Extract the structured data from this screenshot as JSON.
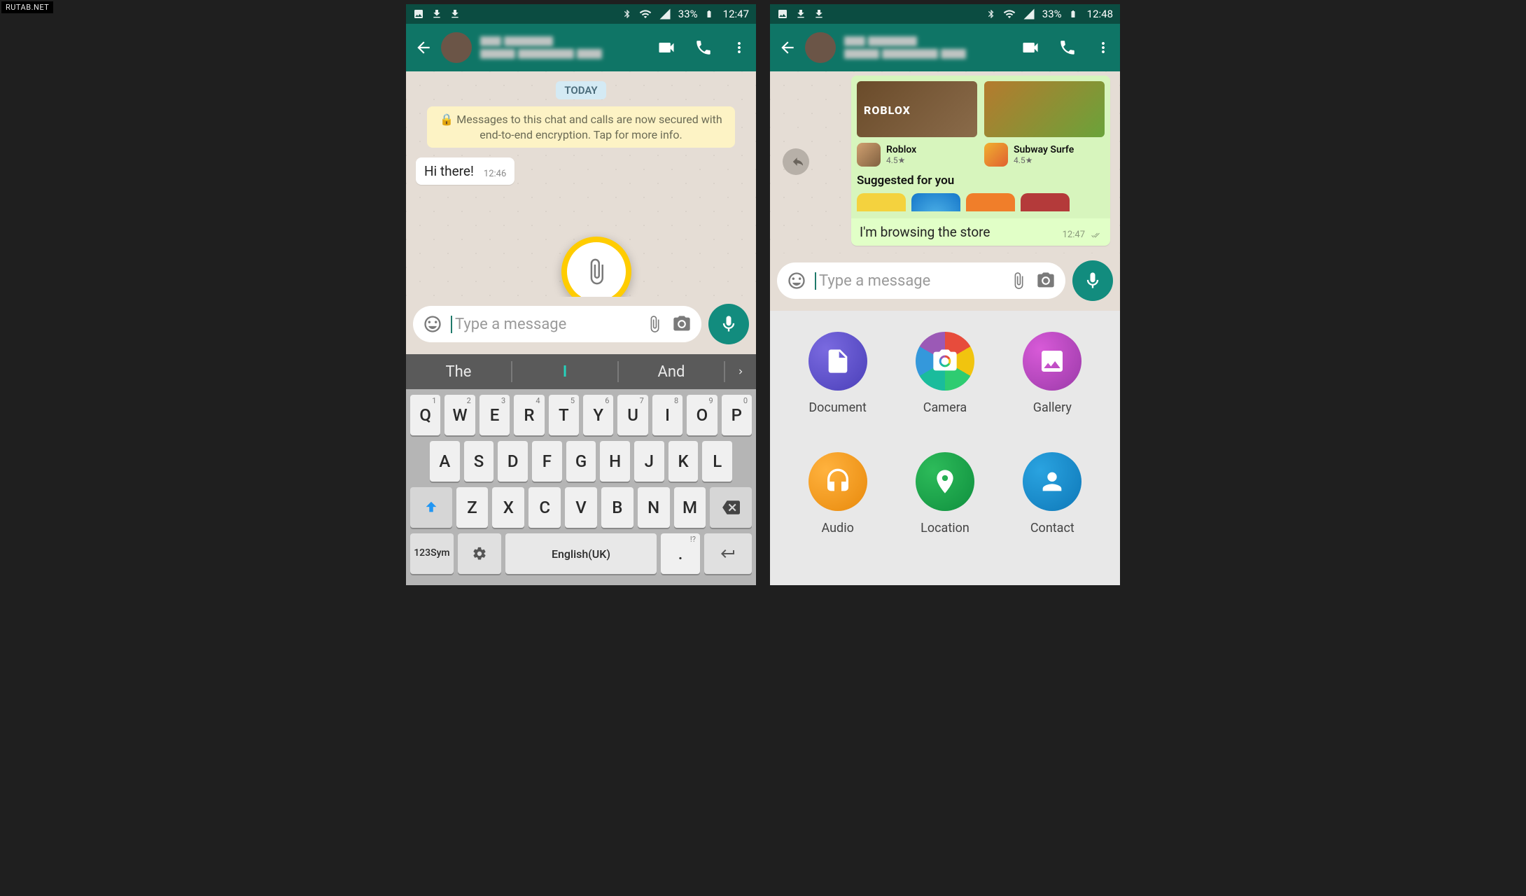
{
  "watermark": "RUTAB.NET",
  "status": {
    "battery": "33%",
    "time_left": "12:47",
    "time_right": "12:48"
  },
  "chat": {
    "day": "TODAY",
    "e2e": "Messages to this chat and calls are now secured with end-to-end encryption. Tap for more info.",
    "incoming": {
      "text": "Hi there!",
      "time": "12:46"
    },
    "outgoing": {
      "app1_name": "Roblox",
      "app1_rating": "4.5★",
      "app2_name": "Subway Surfe",
      "app2_rating": "4.5★",
      "suggested": "Suggested for you",
      "text": "I'm browsing the store",
      "time": "12:47"
    },
    "placeholder": "Type a message"
  },
  "keyboard": {
    "sug1": "The",
    "sug2": "I",
    "sug3": "And",
    "row1": [
      "Q",
      "W",
      "E",
      "R",
      "T",
      "Y",
      "U",
      "I",
      "O",
      "P"
    ],
    "row1sup": [
      "1",
      "2",
      "3",
      "4",
      "5",
      "6",
      "7",
      "8",
      "9",
      "0"
    ],
    "row2": [
      "A",
      "S",
      "D",
      "F",
      "G",
      "H",
      "J",
      "K",
      "L"
    ],
    "row3": [
      "Z",
      "X",
      "C",
      "V",
      "B",
      "N",
      "M"
    ],
    "sym1": "123",
    "sym2": "Sym",
    "space": "English(UK)"
  },
  "attach": {
    "document": "Document",
    "camera": "Camera",
    "gallery": "Gallery",
    "audio": "Audio",
    "location": "Location",
    "contact": "Contact"
  }
}
